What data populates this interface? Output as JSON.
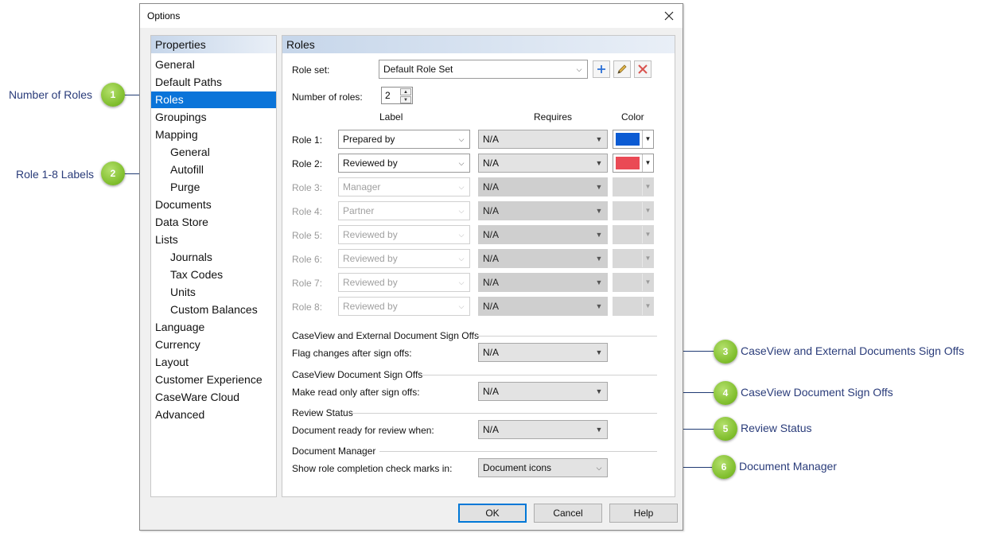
{
  "dialog": {
    "title": "Options"
  },
  "properties": {
    "header": "Properties",
    "items": [
      {
        "label": "General",
        "sub": false
      },
      {
        "label": "Default Paths",
        "sub": false
      },
      {
        "label": "Roles",
        "sub": false,
        "selected": true
      },
      {
        "label": "Groupings",
        "sub": false
      },
      {
        "label": "Mapping",
        "sub": false
      },
      {
        "label": "General",
        "sub": true
      },
      {
        "label": "Autofill",
        "sub": true
      },
      {
        "label": "Purge",
        "sub": true
      },
      {
        "label": "Documents",
        "sub": false
      },
      {
        "label": "Data Store",
        "sub": false
      },
      {
        "label": "Lists",
        "sub": false
      },
      {
        "label": "Journals",
        "sub": true
      },
      {
        "label": "Tax Codes",
        "sub": true
      },
      {
        "label": "Units",
        "sub": true
      },
      {
        "label": "Custom Balances",
        "sub": true
      },
      {
        "label": "Language",
        "sub": false
      },
      {
        "label": "Currency",
        "sub": false
      },
      {
        "label": "Layout",
        "sub": false
      },
      {
        "label": "Customer Experience",
        "sub": false
      },
      {
        "label": "CaseWare Cloud",
        "sub": false
      },
      {
        "label": "Advanced",
        "sub": false
      }
    ]
  },
  "roles_panel": {
    "header": "Roles",
    "role_set_label": "Role set:",
    "role_set_value": "Default Role Set",
    "num_roles_label": "Number of roles:",
    "num_roles_value": "2",
    "col_label": "Label",
    "col_requires": "Requires",
    "col_color": "Color",
    "roles": [
      {
        "name": "Role 1:",
        "label": "Prepared by",
        "requires": "N/A",
        "color": "#0b5bd3",
        "enabled": true
      },
      {
        "name": "Role 2:",
        "label": "Reviewed by",
        "requires": "N/A",
        "color": "#ea4a55",
        "enabled": true
      },
      {
        "name": "Role 3:",
        "label": "Manager",
        "requires": "N/A",
        "color": "",
        "enabled": false
      },
      {
        "name": "Role 4:",
        "label": "Partner",
        "requires": "N/A",
        "color": "",
        "enabled": false
      },
      {
        "name": "Role 5:",
        "label": "Reviewed by",
        "requires": "N/A",
        "color": "",
        "enabled": false
      },
      {
        "name": "Role 6:",
        "label": "Reviewed by",
        "requires": "N/A",
        "color": "",
        "enabled": false
      },
      {
        "name": "Role 7:",
        "label": "Reviewed by",
        "requires": "N/A",
        "color": "",
        "enabled": false
      },
      {
        "name": "Role 8:",
        "label": "Reviewed by",
        "requires": "N/A",
        "color": "",
        "enabled": false
      }
    ],
    "sections": [
      {
        "title": "CaseView and External Document Sign Offs",
        "field_label": "Flag changes after sign offs:",
        "value": "N/A"
      },
      {
        "title": "CaseView Document Sign Offs",
        "field_label": "Make read only after sign offs:",
        "value": "N/A"
      },
      {
        "title": "Review Status",
        "field_label": "Document ready for review when:",
        "value": "N/A"
      },
      {
        "title": "Document Manager",
        "field_label": "Show role completion check marks in:",
        "value": "Document icons"
      }
    ]
  },
  "buttons": {
    "ok": "OK",
    "cancel": "Cancel",
    "help": "Help"
  },
  "callouts": [
    {
      "num": "1",
      "text": "Number of Roles"
    },
    {
      "num": "2",
      "text": "Role 1-8 Labels"
    },
    {
      "num": "3",
      "text": "CaseView and External Documents Sign Offs"
    },
    {
      "num": "4",
      "text": "CaseView Document Sign Offs"
    },
    {
      "num": "5",
      "text": "Review Status"
    },
    {
      "num": "6",
      "text": "Document Manager"
    }
  ]
}
